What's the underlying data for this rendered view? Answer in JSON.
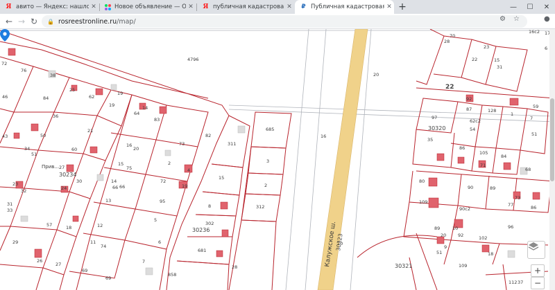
{
  "browser": {
    "tabs": [
      {
        "title": "авито — Яндекс: нашлось 61 млн",
        "favicon": "yandex-icon",
        "active": false
      },
      {
        "title": "Новое объявление — Объявления",
        "favicon": "avito-icon",
        "active": false
      },
      {
        "title": "публичная кадастровая карта —",
        "favicon": "yandex-icon",
        "active": false
      },
      {
        "title": "Публичная кадастровая карта 20",
        "favicon": "rosreestr-icon",
        "active": true
      }
    ],
    "new_tab_symbol": "+",
    "window_controls": {
      "minimize": "—",
      "maximize": "☐",
      "close": "✕"
    },
    "omnibox": {
      "host": "rosreestronline.ru",
      "path": "/map/"
    }
  },
  "map": {
    "street_labels": {
      "highway": "Калужское ш.",
      "side_street": "Прив..."
    },
    "quarter_labels": [
      "30234",
      "30236",
      "30320",
      "30323",
      "30321"
    ],
    "parcel_labels": [
      "4796",
      "20",
      "16",
      "22",
      "685",
      "3",
      "2",
      "312",
      "311",
      "15",
      "8",
      "302",
      "681",
      "28",
      "858",
      "38",
      "25",
      "62",
      "19",
      "76",
      "72",
      "84",
      "36",
      "46",
      "43",
      "21",
      "50",
      "34",
      "51",
      "27",
      "30234",
      "24",
      "32",
      "31",
      "33",
      "60",
      "57",
      "18",
      "29",
      "26",
      "27",
      "12",
      "11",
      "74",
      "69",
      "69",
      "64",
      "83",
      "14",
      "16",
      "20",
      "15",
      "75",
      "14",
      "66",
      "13",
      "73",
      "82",
      "2",
      "4",
      "72",
      "19",
      "95",
      "5",
      "6",
      "7",
      "30",
      "22",
      "70",
      "28",
      "23",
      "15",
      "31",
      "92",
      "87",
      "128",
      "1",
      "59",
      "97",
      "7",
      "62c2",
      "54",
      "86",
      "105",
      "84",
      "71",
      "68",
      "80",
      "90",
      "89",
      "73",
      "77",
      "86",
      "109",
      "90c2",
      "96",
      "89",
      "92",
      "102",
      "109",
      "112",
      "37",
      "6",
      "17",
      "51",
      "20",
      "9",
      "10"
    ],
    "controls": {
      "zoom_in": "+",
      "zoom_out": "−"
    },
    "colors": {
      "parcel_border": "#b8232c",
      "building": "#e0636d",
      "road": "#f0d28a",
      "grey_line": "#b0b4bb"
    }
  }
}
